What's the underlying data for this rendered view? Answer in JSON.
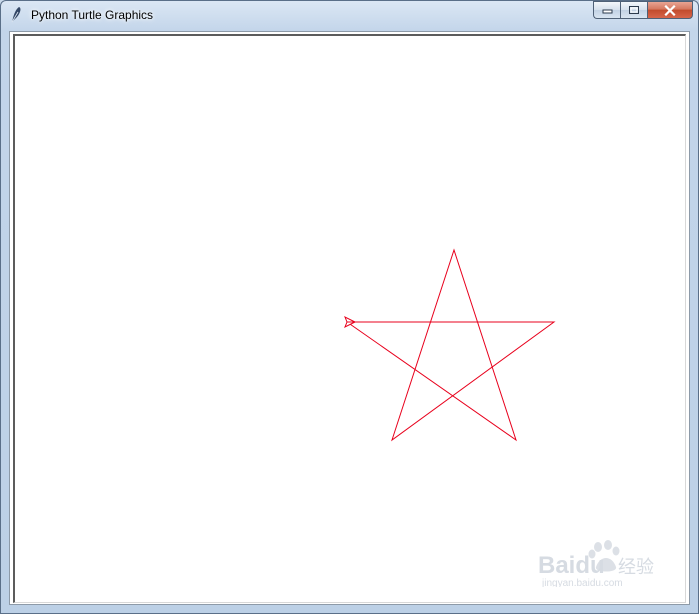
{
  "window": {
    "title": "Python Turtle Graphics",
    "icon": "feather-icon",
    "controls": [
      "minimize-icon",
      "maximize-icon",
      "close-icon"
    ]
  },
  "canvas": {
    "background": "#ffffff",
    "drawing": {
      "shape": "five-pointed star",
      "pen_color": "#e8001c",
      "turtle": "arrow-cursor"
    }
  },
  "watermark": {
    "brand": "Baidu",
    "text": "经验",
    "url": "jingyan.baidu.com"
  }
}
